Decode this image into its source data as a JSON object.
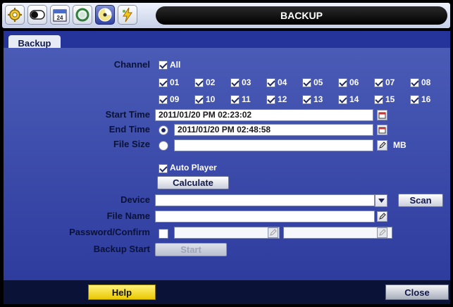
{
  "title": "BACKUP",
  "tabs": [
    {
      "label": "Backup"
    }
  ],
  "icons": [
    "gear-icon",
    "toggle-icon",
    "calendar-icon",
    "search-icon",
    "disc-icon",
    "lightning-icon"
  ],
  "calendar_icon_text": "24",
  "channel": {
    "label": "Channel",
    "all_label": "All",
    "all_checked": true,
    "items": [
      {
        "label": "01",
        "checked": true
      },
      {
        "label": "02",
        "checked": true
      },
      {
        "label": "03",
        "checked": true
      },
      {
        "label": "04",
        "checked": true
      },
      {
        "label": "05",
        "checked": true
      },
      {
        "label": "06",
        "checked": true
      },
      {
        "label": "07",
        "checked": true
      },
      {
        "label": "08",
        "checked": true
      },
      {
        "label": "09",
        "checked": true
      },
      {
        "label": "10",
        "checked": true
      },
      {
        "label": "11",
        "checked": true
      },
      {
        "label": "12",
        "checked": true
      },
      {
        "label": "13",
        "checked": true
      },
      {
        "label": "14",
        "checked": true
      },
      {
        "label": "15",
        "checked": true
      },
      {
        "label": "16",
        "checked": true
      }
    ]
  },
  "start_time": {
    "label": "Start Time",
    "value": "2011/01/20 PM 02:23:02"
  },
  "end_time": {
    "label": "End Time",
    "value": "2011/01/20 PM 02:48:58",
    "selected": true
  },
  "file_size": {
    "label": "File Size",
    "value": "",
    "unit": "MB",
    "selected": false
  },
  "auto_player": {
    "label": "Auto Player",
    "checked": true
  },
  "calculate_label": "Calculate",
  "device": {
    "label": "Device",
    "value": "",
    "scan_label": "Scan"
  },
  "file_name": {
    "label": "File Name",
    "value": ""
  },
  "password": {
    "label": "Password/Confirm",
    "checked": false,
    "value": "",
    "confirm_value": ""
  },
  "backup_start": {
    "label": "Backup Start",
    "button_label": "Start",
    "disabled": true
  },
  "help_label": "Help",
  "close_label": "Close",
  "colors": {
    "panel": "#3a4aa8",
    "tab_strip": "#25349a",
    "help": "#f5dc1e",
    "title_bar": "#000000"
  }
}
